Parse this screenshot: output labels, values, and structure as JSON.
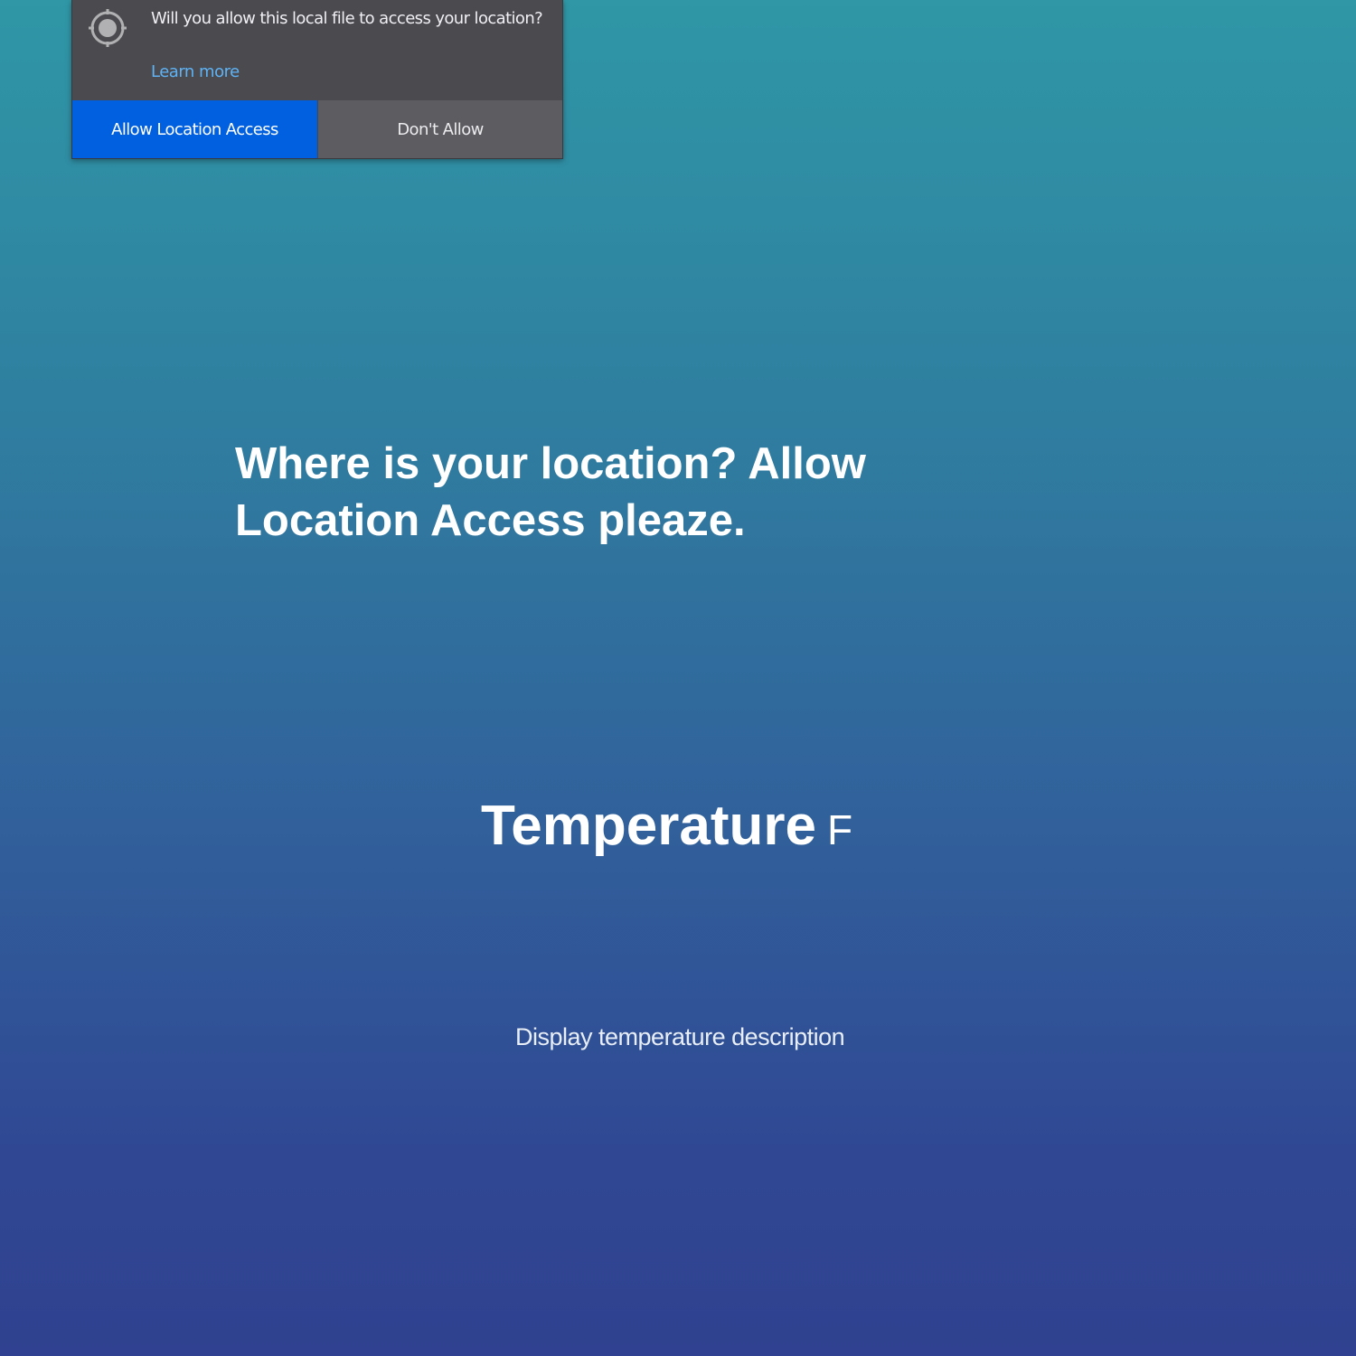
{
  "permission_prompt": {
    "icon": "location-crosshair-icon",
    "question": "Will you allow this local file to access your location?",
    "learn_more": "Learn more",
    "allow_button": "Allow Location Access",
    "deny_button": "Don't Allow",
    "colors": {
      "panel": "#4a4a4f",
      "primary_button": "#0060df",
      "secondary_button": "#5c5c61",
      "link": "#5fb3f5"
    }
  },
  "main": {
    "headline": "Where is your location? Allow Location Access pleaze.",
    "temperature_label": "Temperature",
    "temperature_unit": "F",
    "description": "Display temperature description"
  },
  "background": {
    "gradient_top": "#2f97a6",
    "gradient_bottom": "#2f4190"
  }
}
